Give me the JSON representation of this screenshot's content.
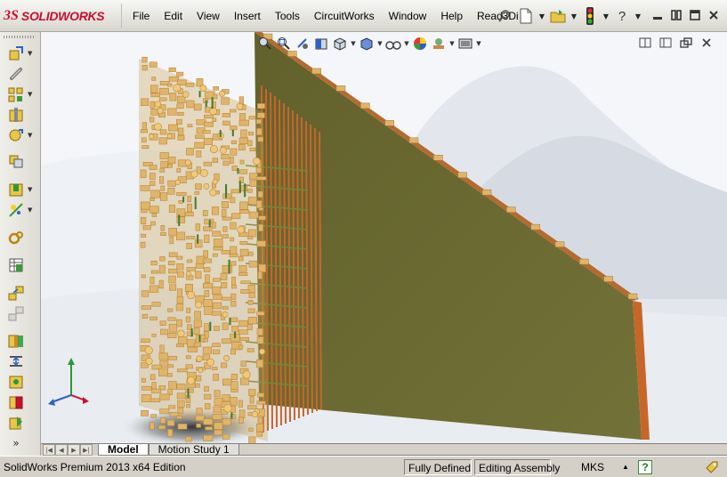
{
  "app": {
    "brand_prefix": "3S",
    "brand_name": "SOLIDWORKS"
  },
  "menu": [
    "File",
    "Edit",
    "View",
    "Insert",
    "Tools",
    "CircuitWorks",
    "Window",
    "Help",
    "Read3Di"
  ],
  "quick_tools": [
    "pin-icon",
    "new-document-icon",
    "open-folder-icon",
    "rebuild-traffic-light-icon",
    "help-question-icon"
  ],
  "window_controls": [
    "minimize-icon",
    "restore-icon",
    "maximize-icon",
    "close-icon"
  ],
  "heads_up_toolbar": [
    "zoom-to-fit-icon",
    "zoom-to-area-icon",
    "previous-view-icon",
    "section-view-icon",
    "view-orientation-icon",
    "display-style-icon",
    "hide-show-items-icon",
    "edit-appearance-icon",
    "apply-scene-icon",
    "view-settings-icon"
  ],
  "doc_controls": [
    "tile-horizontal-icon",
    "tile-vertical-icon",
    "restore-document-icon",
    "close-document-icon"
  ],
  "left_toolbar": [
    "insert-components-icon",
    "mate-icon",
    "linear-component-pattern-icon",
    "smart-fasteners-icon",
    "move-component-icon",
    "show-hidden-components-icon",
    "assembly-features-icon",
    "reference-geometry-icon",
    "new-motion-study-icon",
    "bill-of-materials-icon",
    "exploded-view-icon",
    "explode-line-sketch-icon",
    "interference-detection-icon",
    "clearance-verification-icon",
    "hole-alignment-icon",
    "assembly-visualization-icon",
    "performance-evaluation-icon",
    "more-tools-icon"
  ],
  "tabs": {
    "model": "Model",
    "motion": "Motion Study 1"
  },
  "status": {
    "product": "SolidWorks Premium 2013 x64 Edition",
    "definition": "Fully Defined",
    "mode": "Editing Assembly",
    "units": "MKS",
    "help": "?"
  },
  "colors": {
    "board": "#6c6b32",
    "copper": "#e0b46a",
    "traces": "#c8662a",
    "brand_red": "#c8102e"
  }
}
